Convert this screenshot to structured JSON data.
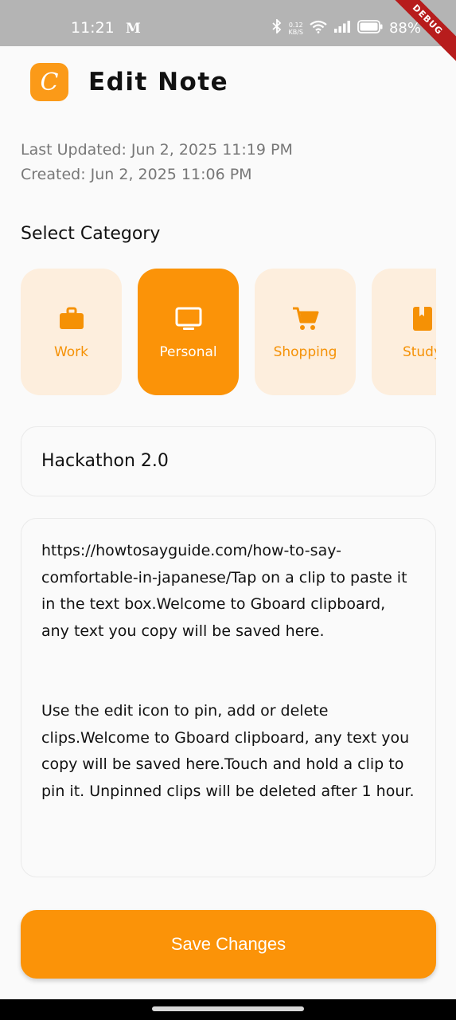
{
  "status_bar": {
    "time": "11:21",
    "carrier": "M",
    "net_speed_value": "0.12",
    "net_speed_unit": "KB/S",
    "battery": "88%",
    "debug_label": "DEBUG"
  },
  "header": {
    "logo_letter": "C",
    "title": "Edit Note"
  },
  "meta": {
    "last_updated": "Last Updated: Jun 2, 2025 11:19 PM",
    "created": "Created: Jun 2, 2025 11:06 PM"
  },
  "category_section": {
    "label": "Select Category",
    "selected": "Personal",
    "items": [
      {
        "label": "Work",
        "icon": "briefcase-icon"
      },
      {
        "label": "Personal",
        "icon": "monitor-icon"
      },
      {
        "label": "Shopping",
        "icon": "cart-icon"
      },
      {
        "label": "Study",
        "icon": "book-icon"
      }
    ]
  },
  "note": {
    "title": "Hackathon 2.0",
    "body": "https://howtosayguide.com/how-to-say-comfortable-in-japanese/Tap on a clip to paste it in the text box.Welcome to Gboard clipboard, any text you copy will be saved here.\n\n\nUse the edit icon to pin, add or delete clips.Welcome to Gboard clipboard, any text you copy will be saved here.Touch and hold a clip to pin it. Unpinned clips will be deleted after 1 hour."
  },
  "actions": {
    "save_label": "Save Changes"
  },
  "colors": {
    "accent": "#fb9308",
    "accent_light": "#fdeedd",
    "status_bar": "#b4b4b4"
  }
}
